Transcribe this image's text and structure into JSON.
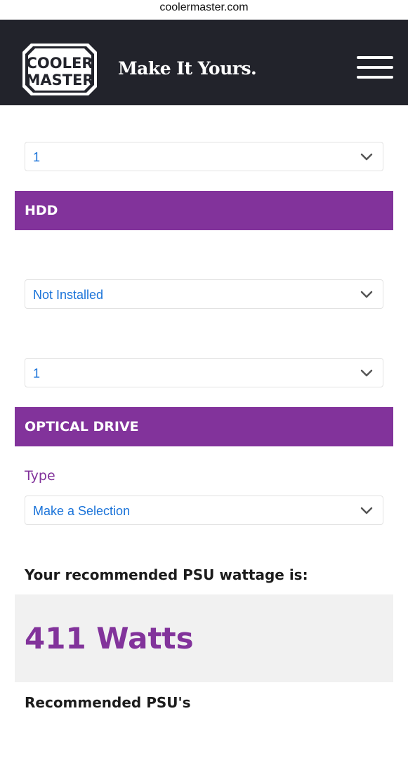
{
  "browser": {
    "url": "coolermaster.com"
  },
  "header": {
    "logo_line1": "COOLER",
    "logo_line2": "MASTER",
    "tagline": "Make It Yours.",
    "menu_icon": "hamburger-menu-icon"
  },
  "selects": {
    "top_quantity": "1",
    "hdd_type": "Not Installed",
    "hdd_quantity": "1",
    "optical_type": "Make a Selection"
  },
  "sections": {
    "hdd": "HDD",
    "optical": "OPTICAL DRIVE"
  },
  "labels": {
    "type": "Type"
  },
  "result": {
    "heading": "Your recommended PSU wattage is:",
    "wattage": "411 Watts",
    "psu_heading": "Recommended PSU's"
  },
  "colors": {
    "brand_purple": "#82339b",
    "header_bg": "#22232b",
    "select_text": "#1a73d9"
  }
}
